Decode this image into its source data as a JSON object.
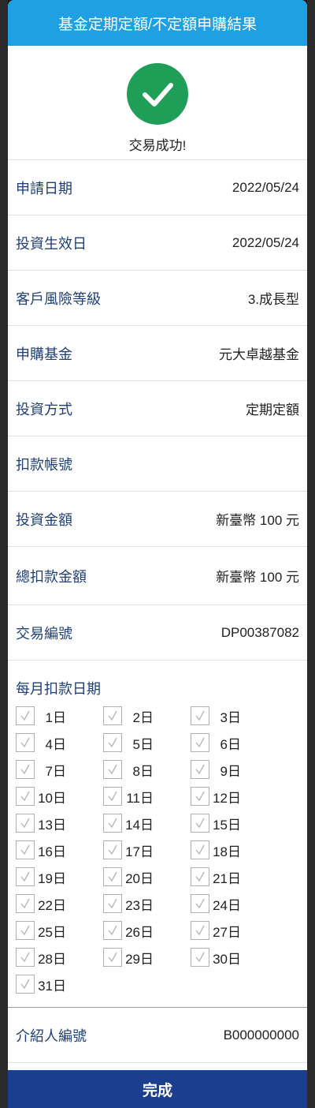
{
  "header": {
    "title": "基金定期定額/不定額申購結果"
  },
  "status": {
    "text": "交易成功!",
    "icon": "check-icon",
    "color": "#1f9e57"
  },
  "details": [
    {
      "label": "申請日期",
      "value": "2022/05/24"
    },
    {
      "label": "投資生效日",
      "value": "2022/05/24"
    },
    {
      "label": "客戶風險等級",
      "value": "3.成長型"
    },
    {
      "label": "申購基金",
      "value": "元大卓越基金"
    },
    {
      "label": "投資方式",
      "value": "定期定額"
    },
    {
      "label": "扣款帳號",
      "value": ""
    },
    {
      "label": "投資金額",
      "value": "新臺幣 100 元"
    },
    {
      "label": "總扣款金額",
      "value": "新臺幣 100 元"
    },
    {
      "label": "交易編號",
      "value": "DP00387082"
    }
  ],
  "deduction_days": {
    "title": "每月扣款日期",
    "days": [
      "1日",
      "2日",
      "3日",
      "4日",
      "5日",
      "6日",
      "7日",
      "8日",
      "9日",
      "10日",
      "11日",
      "12日",
      "13日",
      "14日",
      "15日",
      "16日",
      "17日",
      "18日",
      "19日",
      "20日",
      "21日",
      "22日",
      "23日",
      "24日",
      "25日",
      "26日",
      "27日",
      "28日",
      "29日",
      "30日",
      "31日"
    ]
  },
  "referrer": {
    "label": "介紹人編號",
    "value": "B000000000"
  },
  "footer": {
    "done_label": "完成"
  },
  "colors": {
    "header": "#1ea0e2",
    "button": "#1b3f8f",
    "label": "#1f3f7a"
  }
}
